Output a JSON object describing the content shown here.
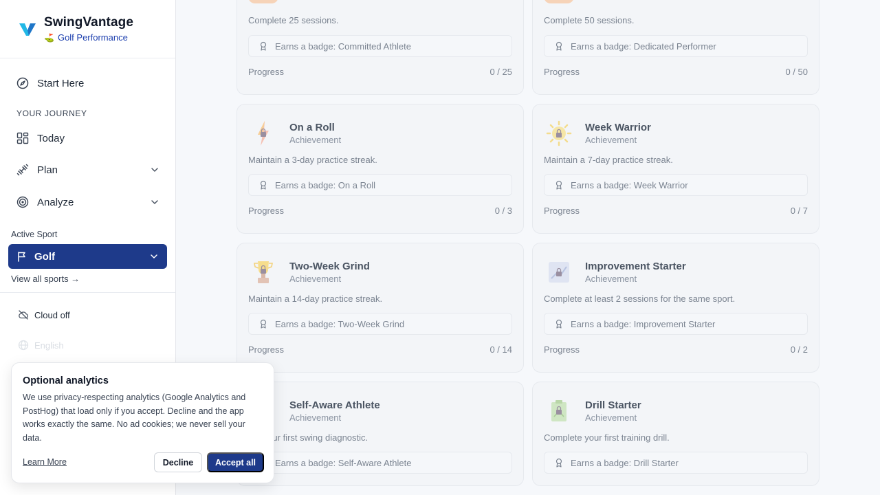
{
  "brand": {
    "title": "SwingVantage",
    "subtitle": "Golf Performance",
    "subtitle_icon": "golf-flag-emoji",
    "accent_color": "#1e40af"
  },
  "sidebar": {
    "start_here": "Start Here",
    "section_label": "YOUR JOURNEY",
    "items": [
      {
        "label": "Today",
        "icon": "dashboard-grid-icon"
      },
      {
        "label": "Plan",
        "icon": "dumbbell-icon",
        "expandable": true
      },
      {
        "label": "Analyze",
        "icon": "target-icon",
        "expandable": true
      }
    ],
    "active_sport_label": "Active Sport",
    "active_sport": "Golf",
    "view_all_sports": "View all sports →",
    "cloud_status": "Cloud off",
    "language": "English"
  },
  "cards": [
    {
      "title": "",
      "type": "Achievement",
      "description": "Complete 25 sessions.",
      "badge": "Earns a badge: Committed Athlete",
      "progress_label": "Progress",
      "progress": "0 / 25"
    },
    {
      "title": "",
      "type": "Achievement",
      "description": "Complete 50 sessions.",
      "badge": "Earns a badge: Dedicated Performer",
      "progress_label": "Progress",
      "progress": "0 / 50"
    },
    {
      "title": "On a Roll",
      "type": "Achievement",
      "description": "Maintain a 3-day practice streak.",
      "badge": "Earns a badge: On a Roll",
      "progress_label": "Progress",
      "progress": "0 / 3"
    },
    {
      "title": "Week Warrior",
      "type": "Achievement",
      "description": "Maintain a 7-day practice streak.",
      "badge": "Earns a badge: Week Warrior",
      "progress_label": "Progress",
      "progress": "0 / 7"
    },
    {
      "title": "Two-Week Grind",
      "type": "Achievement",
      "description": "Maintain a 14-day practice streak.",
      "badge": "Earns a badge: Two-Week Grind",
      "progress_label": "Progress",
      "progress": "0 / 14"
    },
    {
      "title": "Improvement Starter",
      "type": "Achievement",
      "description": "Complete at least 2 sessions for the same sport.",
      "badge": "Earns a badge: Improvement Starter",
      "progress_label": "Progress",
      "progress": "0 / 2"
    },
    {
      "title": "Self-Aware Athlete",
      "type": "Achievement",
      "description": "ete your first swing diagnostic.",
      "badge": "Earns a badge: Self-Aware Athlete",
      "progress_label": "",
      "progress": ""
    },
    {
      "title": "Drill Starter",
      "type": "Achievement",
      "description": "Complete your first training drill.",
      "badge": "Earns a badge: Drill Starter",
      "progress_label": "",
      "progress": ""
    }
  ],
  "cookie": {
    "title": "Optional analytics",
    "body": "We use privacy-respecting analytics (Google Analytics and PostHog) that load only if you accept. Decline and the app works exactly the same. No ad cookies; we never sell your data.",
    "learn_more": "Learn More",
    "decline": "Decline",
    "accept": "Accept all"
  }
}
